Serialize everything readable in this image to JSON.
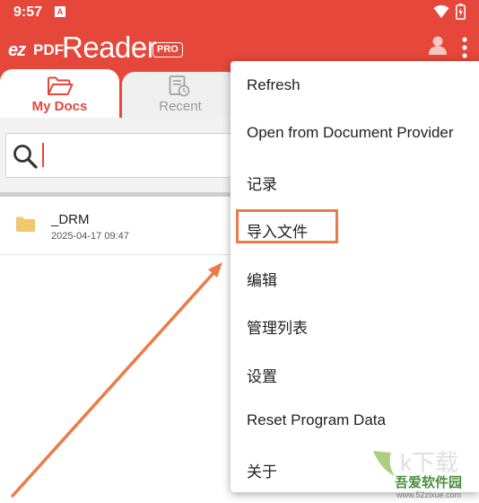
{
  "status_bar": {
    "time": "9:57",
    "notif_icon": "a-icon"
  },
  "app": {
    "logo": {
      "ez": "ez",
      "pdf": "PDF",
      "reader": "Reader",
      "badge": "PRO"
    },
    "accent": "#e5473a"
  },
  "tabs": [
    {
      "label": "My Docs",
      "icon": "folder-open-icon",
      "selected": true
    },
    {
      "label": "Recent",
      "icon": "recent-doc-icon",
      "selected": false
    }
  ],
  "search": {
    "value": ""
  },
  "files": [
    {
      "name": "_DRM",
      "date": "2025-04-17 09:47",
      "icon": "folder-icon"
    }
  ],
  "menu": {
    "items": [
      {
        "label": "Refresh"
      },
      {
        "label": "Open from Document Provider"
      },
      {
        "label": "记录"
      },
      {
        "label": "导入文件",
        "highlighted": true
      },
      {
        "label": "编辑"
      },
      {
        "label": "管理列表"
      },
      {
        "label": "设置"
      },
      {
        "label": "Reset Program Data"
      },
      {
        "label": "关于"
      }
    ]
  },
  "annotation": {
    "color": "#ee7a47"
  },
  "watermark": {
    "text": "吾爱软件园",
    "url": "www.52zixue.com"
  }
}
